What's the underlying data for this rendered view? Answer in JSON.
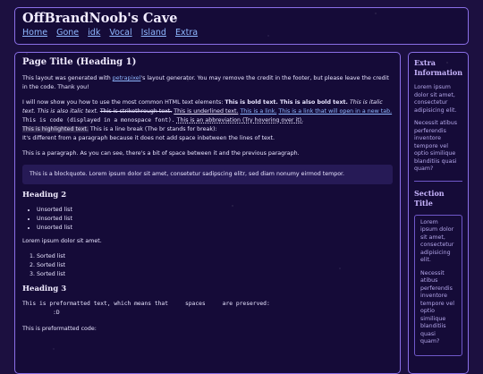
{
  "header": {
    "site_title": "OffBrandNoob's Cave",
    "nav": [
      "Home",
      "Gone",
      "idk",
      "Vocal",
      "Island",
      "Extra"
    ]
  },
  "main": {
    "h1": "Page Title (Heading 1)",
    "intro": {
      "before": "This layout was generated with ",
      "link": "petrapixel",
      "after": "'s layout generator. You may remove the credit in the footer, but please leave the credit in the code. Thank you!"
    },
    "elements": {
      "lead": "I will now show you how to use the most common HTML text elements: ",
      "bold1": "This is bold text.",
      "bold2": "This is also bold text.",
      "italic1": "This is italic text.",
      "italic2": "This is also italic text.",
      "strike": "This is strikethrough text.",
      "underline": "This is underlined text.",
      "link1": "This is a link.",
      "link2": "This is a link that will open in a new tab.",
      "code": "This is code (displayed in a monospace font).",
      "abbr": "This is an abbreviation (Try hovering over it).",
      "highlight": "This is highlighted text.",
      "linebreak1": "This is a line break (The br stands for break):",
      "linebreak2": "It's different from a paragraph because it does not add space inbetween the lines of text."
    },
    "paragraph": "This is a paragraph. As you can see, there's a bit of space between it and the previous paragraph.",
    "blockquote": "This is a blockquote. Lorem ipsum dolor sit amet, consetetur sadipscing elitr, sed diam nonumy eirmod tempor.",
    "h2": "Heading 2",
    "unsorted": [
      "Unsorted list",
      "Unsorted list",
      "Unsorted list"
    ],
    "lorem": "Lorem ipsum dolor sit amet.",
    "sorted": [
      "Sorted list",
      "Sorted list",
      "Sorted list"
    ],
    "h3": "Heading 3",
    "pre1": "This is preformatted text, which means that     spaces     are preserved:\n         :D",
    "pre_label": "This is preformatted code:"
  },
  "sidebar": {
    "title1": "Extra Information",
    "text1": "Lorem ipsum dolor sit amet, consectetur adipisicing elit.",
    "text2": "Necessit atibus perferendis inventore tempore vel optio similique blanditiis quasi quam?",
    "title2": "Section Title",
    "box_text1": "Lorem ipsum dolor sit amet, consectetur adipisicing elit.",
    "box_text2": "Necessit atibus perferendis inventore tempore vel optio similique blanditiis quasi quam?"
  }
}
